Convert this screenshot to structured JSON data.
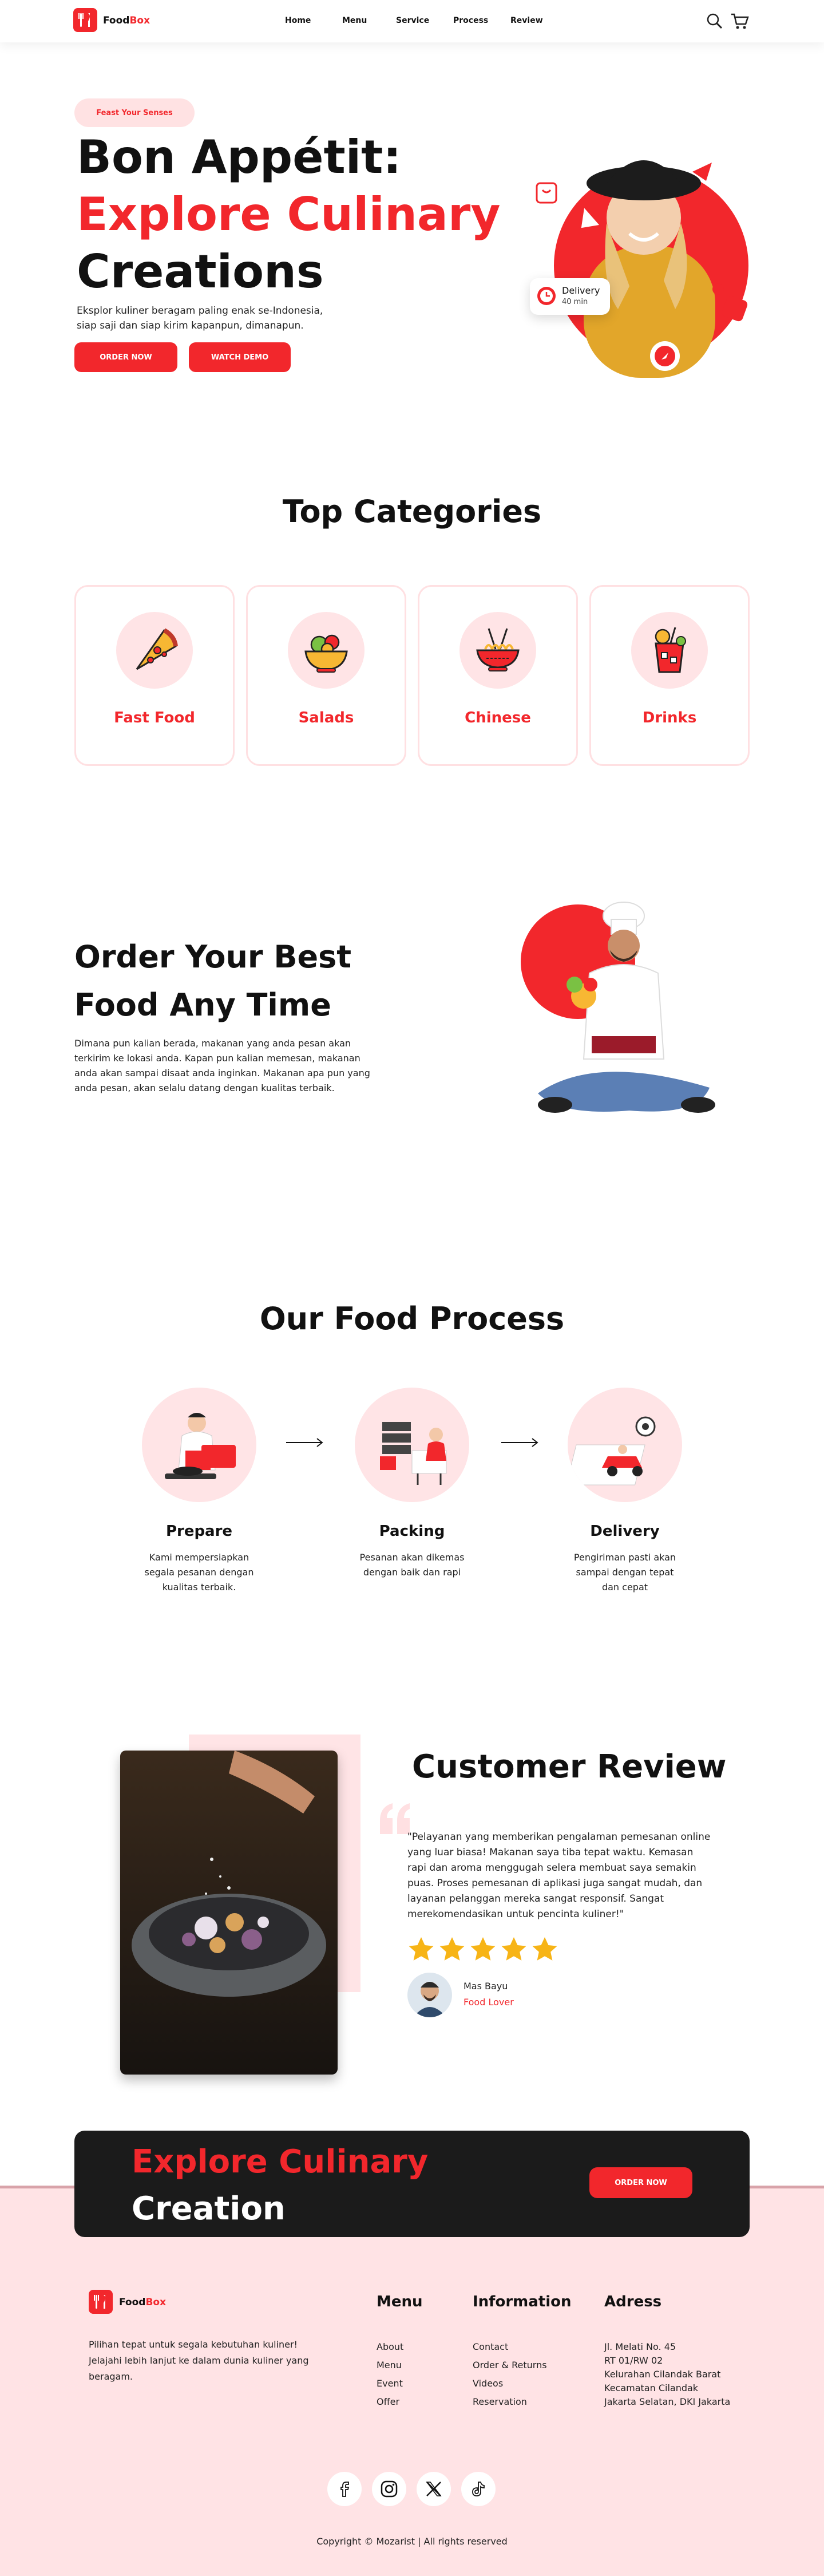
{
  "brand": {
    "part1": "Food",
    "part2": "Box",
    "accent": "#f2272c"
  },
  "nav": {
    "links": [
      "Home",
      "Menu",
      "Service",
      "Process",
      "Review"
    ],
    "icons": [
      "search-icon",
      "cart-icon"
    ]
  },
  "hero": {
    "pill": "Feast Your Senses",
    "line1": "Bon Appétit:",
    "line2": "Explore Culinary",
    "line3": "Creations",
    "desc": "Eksplor kuliner beragam paling enak se-Indonesia, siap saji dan siap kirim kapanpun, dimanapun.",
    "order_label": "ORDER NOW",
    "demo_label": "WATCH DEMO",
    "delivery_title": "Delivery",
    "delivery_time": "40 min"
  },
  "categories": {
    "title": "Top Categories",
    "items": [
      {
        "label": "Fast Food",
        "icon": "pizza-icon"
      },
      {
        "label": "Salads",
        "icon": "salad-icon"
      },
      {
        "label": "Chinese",
        "icon": "noodles-icon"
      },
      {
        "label": "Drinks",
        "icon": "drink-icon"
      }
    ]
  },
  "order": {
    "title_line1": "Order Your Best",
    "title_line2": "Food Any Time",
    "desc": "Dimana pun kalian berada, makanan yang anda pesan akan terkirim ke lokasi anda. Kapan pun kalian memesan, makanan anda akan sampai disaat anda inginkan. Makanan apa pun yang anda pesan, akan selalu datang dengan kualitas terbaik."
  },
  "process": {
    "title": "Our Food Process",
    "steps": [
      {
        "title": "Prepare",
        "desc": "Kami mempersiapkan segala pesanan dengan kualitas terbaik."
      },
      {
        "title": "Packing",
        "desc": "Pesanan akan dikemas dengan baik dan rapi"
      },
      {
        "title": "Delivery",
        "desc": "Pengiriman pasti akan sampai dengan tepat dan cepat"
      }
    ]
  },
  "review": {
    "title": "Customer Review",
    "quote": "\"Pelayanan yang memberikan pengalaman pemesanan online yang luar biasa! Makanan saya tiba tepat waktu. Kemasan rapi dan aroma menggugah selera membuat saya semakin puas. Proses pemesanan di aplikasi juga sangat mudah, dan layanan pelanggan mereka sangat responsif. Sangat merekomendasikan untuk pencinta kuliner!\"",
    "rating": 5,
    "name": "Mas Bayu",
    "role": "Food Lover"
  },
  "banner": {
    "line1": "Explore Culinary",
    "line2": "Creation",
    "button": "ORDER NOW"
  },
  "footer": {
    "desc": "Pilihan tepat untuk segala kebutuhan kuliner! Jelajahi lebih lanjut ke dalam dunia kuliner yang beragam.",
    "menu_title": "Menu",
    "menu_links": [
      "About",
      "Menu",
      "Event",
      "Offer"
    ],
    "info_title": "Information",
    "info_links": [
      "Contact",
      "Order & Returns",
      "Videos",
      "Reservation"
    ],
    "address_title": "Adress",
    "address_lines": [
      "Jl. Melati No. 45",
      "RT 01/RW 02",
      "Kelurahan Cilandak Barat",
      "Kecamatan Cilandak",
      "Jakarta Selatan, DKI Jakarta"
    ],
    "socials": [
      "facebook-icon",
      "instagram-icon",
      "x-icon",
      "tiktok-icon"
    ],
    "copyright": "Copyright © Mozarist | All rights reserved"
  }
}
